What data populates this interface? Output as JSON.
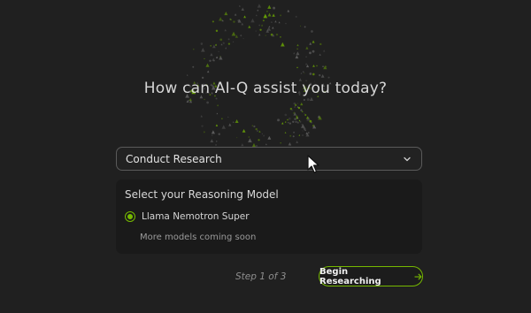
{
  "heading": "How can AI-Q assist you today?",
  "mode_select": {
    "value": "Conduct Research",
    "icon": "chevron-down-icon"
  },
  "reasoning_panel": {
    "title": "Select your Reasoning Model",
    "options": [
      {
        "label": "Llama Nemotron Super",
        "selected": true
      }
    ],
    "note": "More models coming soon"
  },
  "footer": {
    "step_text": "Step 1 of 3",
    "begin_button": {
      "label": "Begin Researching",
      "icon": "arrow-right-icon"
    }
  },
  "colors": {
    "background": "#202020",
    "accent": "#76b900",
    "panel": "#1a1a1a"
  }
}
